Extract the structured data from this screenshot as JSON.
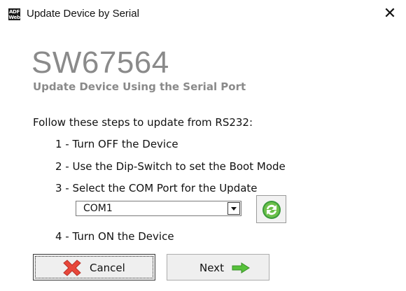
{
  "window": {
    "title": "Update Device by Serial",
    "icon_top": "ADF",
    "icon_bottom": "Web",
    "close_glyph": "✕"
  },
  "header": {
    "app_name": "SW67564",
    "subtitle": "Update Device Using the Serial Port"
  },
  "instructions": {
    "intro": "Follow these steps to update from RS232:",
    "steps": [
      "1 - Turn OFF the Device",
      "2 - Use the Dip-Switch to set the Boot Mode",
      "3 - Select the COM Port for the Update",
      "4 - Turn ON the Device"
    ]
  },
  "com_port": {
    "selected": "COM1"
  },
  "buttons": {
    "cancel_label": "Cancel",
    "next_label": "Next"
  },
  "icons": {
    "refresh": "refresh-icon",
    "cancel": "cross-icon",
    "next": "arrow-right-icon"
  },
  "colors": {
    "heading_gray": "#8a8a8a",
    "refresh_green": "#3a9a3a",
    "cancel_red": "#e8473a",
    "next_green": "#56c23a"
  }
}
